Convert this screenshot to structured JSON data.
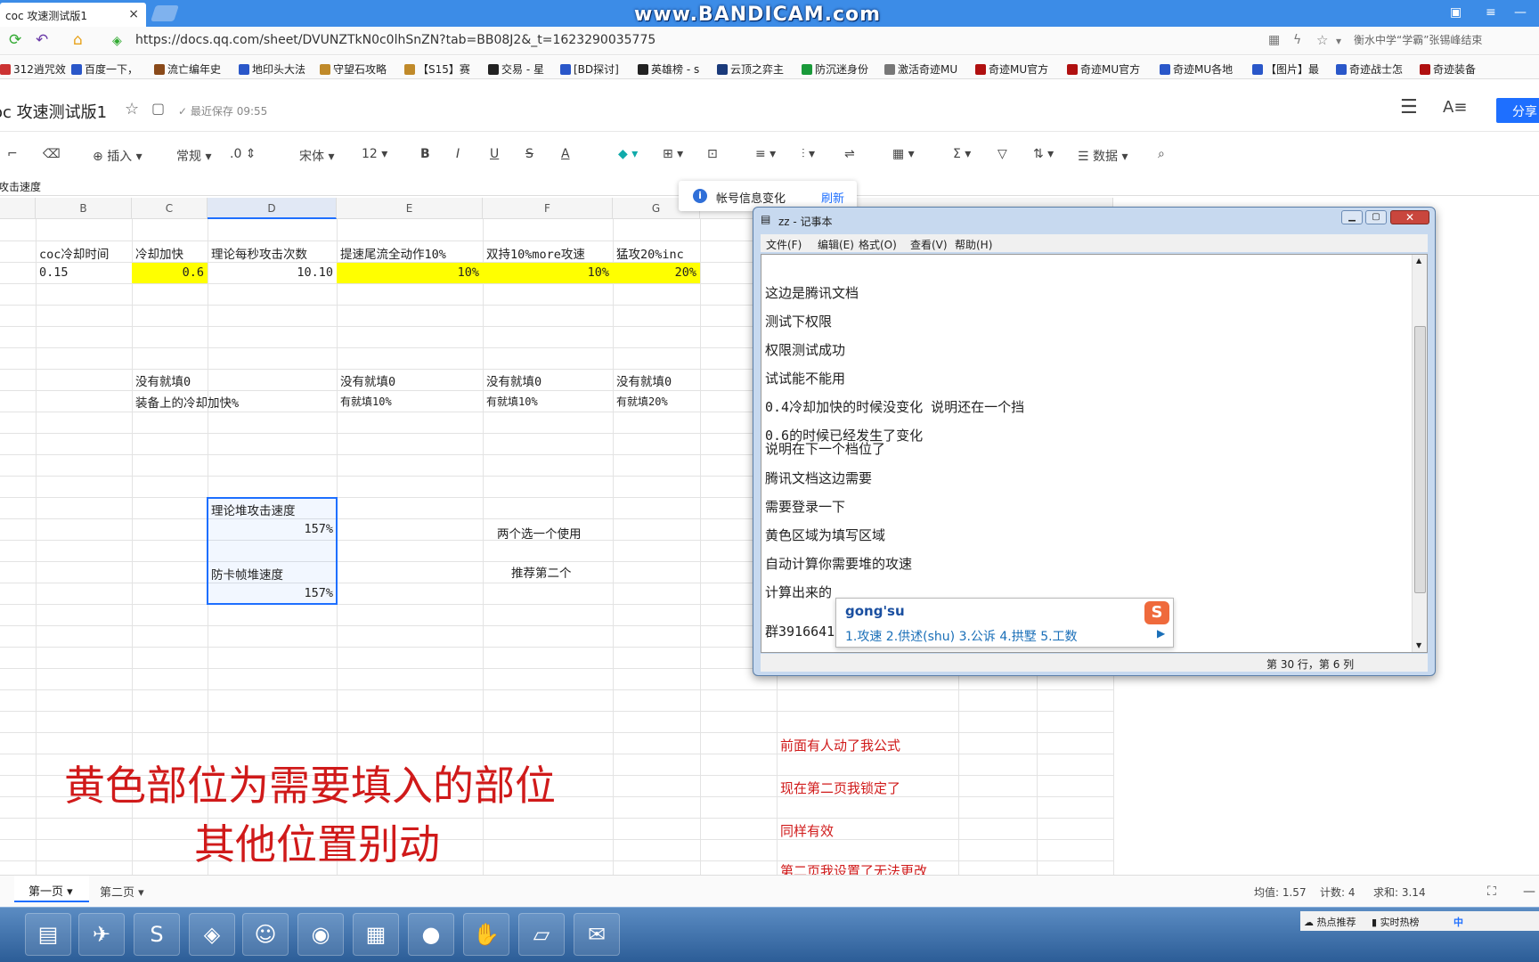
{
  "browser": {
    "tab_title": "coc 攻速测试版1",
    "tab_close": "×",
    "watermark": "www.BANDICAM.com",
    "url": "https://docs.qq.com/sheet/DVUNZTkN0c0lhSnZN?tab=BB08J2&_t=1623290035775",
    "search_text": "衡水中学“学霸”张锡峰结束",
    "bookmarks": [
      "312逍咒效",
      "百度一下，",
      "流亡编年史",
      "地印头大法",
      "守望石攻略",
      "【S15】赛",
      "交易 - 星",
      "[BD探讨]",
      "英雄榜 - s",
      "云顶之弈主",
      "防沉迷身份",
      "激活奇迹MU",
      "奇迹MU官方",
      "奇迹MU官方",
      "奇迹MU各地",
      "【图片】最",
      "奇迹战士怎",
      "奇迹装备"
    ]
  },
  "doc": {
    "title": "oc 攻速测试版1",
    "saved": "最近保存 09:55",
    "share": "分享",
    "cell_name": "攻击速度"
  },
  "toolbar": {
    "insert": "插入",
    "format": "常规",
    "decimal": ".0",
    "font": "宋体",
    "size": "12",
    "bold": "B",
    "italic": "I",
    "underline": "U",
    "strike": "S",
    "fontcolor": "A",
    "sum": "Σ",
    "data": "数据"
  },
  "notify": {
    "text": "帐号信息变化",
    "action": "刷新"
  },
  "sheet": {
    "columns": [
      "B",
      "C",
      "D",
      "E",
      "F",
      "G"
    ],
    "header_row": [
      "coc冷却时间",
      "冷却加快",
      "理论每秒攻击次数",
      "提速尾流全动作10%",
      "双持10%more攻速",
      "猛攻20%inc"
    ],
    "value_row": [
      "0.15",
      "0.6",
      "10.10",
      "10%",
      "10%",
      "20%"
    ],
    "hint1": [
      "没有就填0",
      "没有就填0",
      "没有就填0",
      "没有就填0"
    ],
    "hint2": [
      "装备上的冷却加快%",
      "有就填10%",
      "有就填10%",
      "有就填20%"
    ],
    "theory_label": "理论堆攻击速度",
    "theory_value": "157%",
    "anti_label": "防卡帧堆速度",
    "anti_value": "157%",
    "choose_one": "两个选一个使用",
    "recommend": "推荐第二个",
    "big_line1": "黄色部位为需要填入的部位",
    "big_line2": "其他位置别动",
    "red_notes": [
      "前面有人动了我公式",
      "现在第二页我锁定了",
      "同样有效",
      "第二页我设置了无法更改"
    ]
  },
  "sheettabs": {
    "page1": "第一页",
    "page2": "第二页",
    "avg": "均值: 1.57",
    "count": "计数: 4",
    "sum": "求和: 3.14"
  },
  "notepad": {
    "title": "zz - 记事本",
    "menu": [
      "文件(F)",
      "编辑(E)",
      "格式(O)",
      "查看(V)",
      "帮助(H)"
    ],
    "lines": [
      "这边是腾讯文档",
      "测试下权限",
      "权限测试成功",
      "试试能不能用",
      "0.4冷却加快的时候没变化   说明还在一个挡",
      "0.6的时候已经发生了变化",
      "说明在下一个档位了",
      "腾讯文档这边需要",
      "需要登录一下",
      "黄色区域为填写区域",
      "自动计算你需要堆的攻速",
      "计算出来的",
      "群3916641"
    ],
    "status": "第 30 行，第 6 列"
  },
  "ime": {
    "typed": "gong'su",
    "candidates": "1.攻速  2.供述(shu)  3.公诉  4.拱墅  5.工数",
    "logo": "S"
  },
  "tray": {
    "hot": "热点推荐",
    "realtime": "实时热榜",
    "lang": "中"
  }
}
